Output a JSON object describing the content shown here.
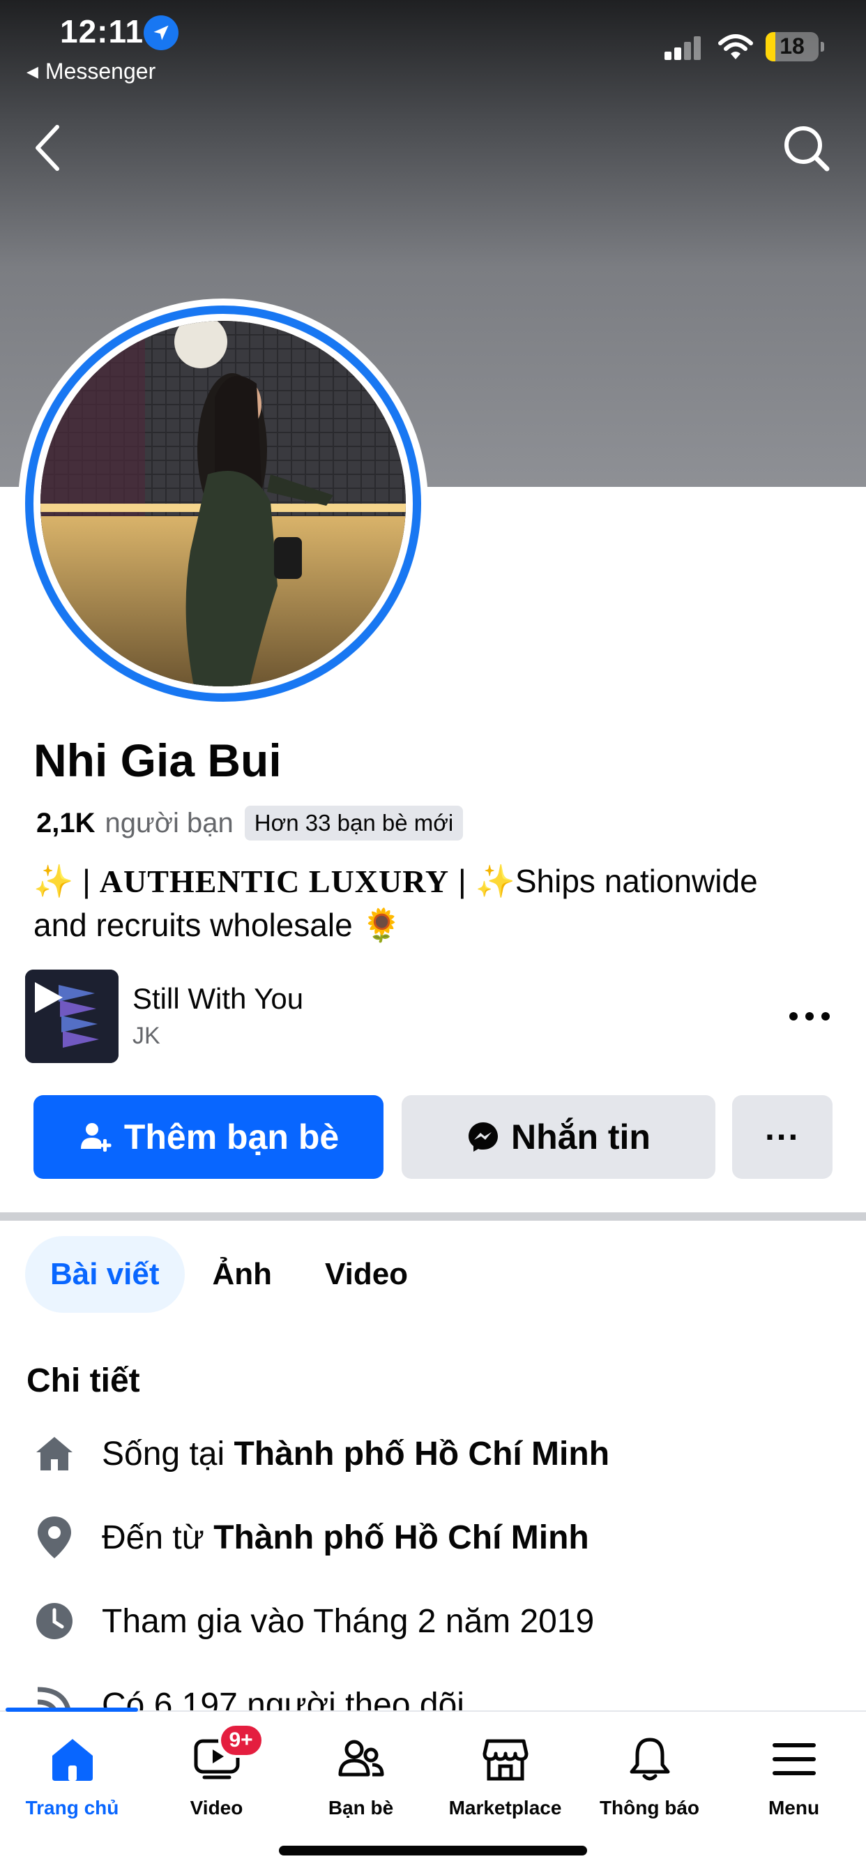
{
  "status_bar": {
    "time": "12:11",
    "back_app": "Messenger",
    "battery": "18"
  },
  "profile": {
    "name": "Nhi Gia Bui",
    "friends_count": "2,1K",
    "friends_label": "người bạn",
    "new_friends": "Hơn 33 bạn bè mới",
    "bio_prefix": "✨ | ",
    "bio_luxury": "AUTHENTIC LUXURY",
    "bio_middle": " | ✨Ships nationwide and recruits wholesale ",
    "bio_suffix": "🌻"
  },
  "music": {
    "title": "Still With You",
    "artist": "JK"
  },
  "actions": {
    "add_friend": "Thêm bạn bè",
    "message": "Nhắn tin",
    "more": "···"
  },
  "tabs": [
    {
      "label": "Bài viết",
      "active": true
    },
    {
      "label": "Ảnh",
      "active": false
    },
    {
      "label": "Video",
      "active": false
    }
  ],
  "details": {
    "title": "Chi tiết",
    "lives_prefix": "Sống tại ",
    "lives_city": "Thành phố Hồ Chí Minh",
    "from_prefix": "Đến từ ",
    "from_city": "Thành phố Hồ Chí Minh",
    "joined": "Tham gia vào Tháng 2 năm 2019",
    "followers": "Có 6.197 người theo dõi"
  },
  "bottom_nav": {
    "items": [
      {
        "label": "Trang chủ",
        "icon": "home-icon",
        "active": true
      },
      {
        "label": "Video",
        "icon": "video-icon",
        "badge": "9+"
      },
      {
        "label": "Bạn bè",
        "icon": "friends-icon"
      },
      {
        "label": "Marketplace",
        "icon": "marketplace-icon"
      },
      {
        "label": "Thông báo",
        "icon": "bell-icon"
      },
      {
        "label": "Menu",
        "icon": "menu-icon"
      }
    ]
  },
  "colors": {
    "primary": "#0866ff",
    "story_ring": "#1877f2",
    "secondary_button": "#e4e6eb",
    "badge": "#e41e3f"
  }
}
